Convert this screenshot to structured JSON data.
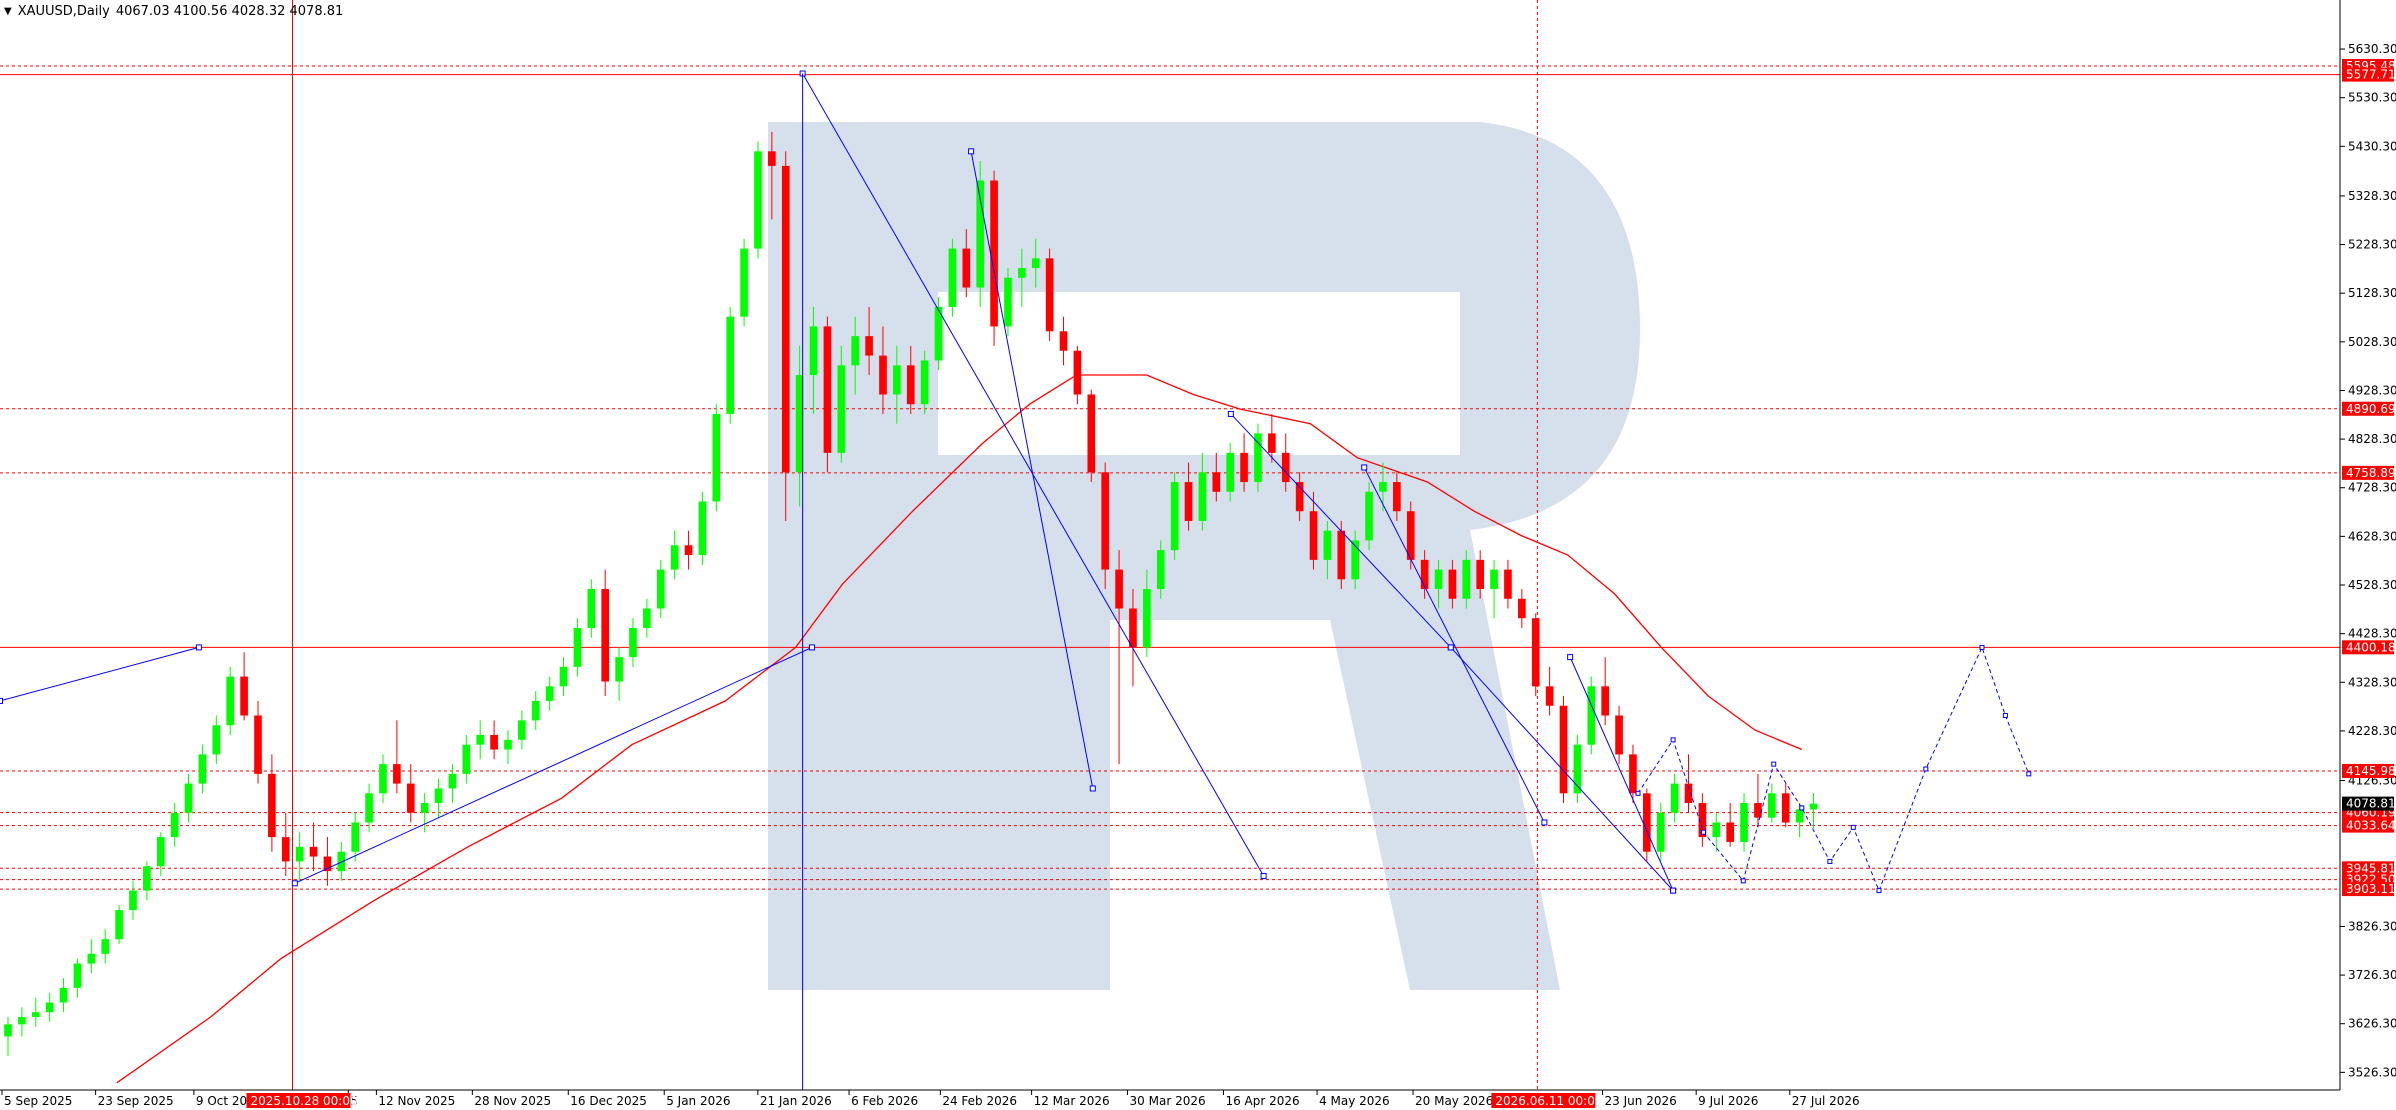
{
  "header": {
    "menu_arrow": "▼",
    "symbol": "XAUUSD,Daily",
    "ohlc": "4067.03 4100.56 4028.32 4078.81"
  },
  "colors": {
    "bull": "#00ff00",
    "bear": "#ff0000",
    "grid_level": "#ff0000",
    "trend": "#0000ff",
    "ma": "#ff0000",
    "watermark": "#d6dfec",
    "label_bg": "#ff0000",
    "label_text": "#ffffff"
  },
  "chart_data": {
    "type": "candlestick",
    "symbol": "XAUUSD",
    "timeframe": "Daily",
    "last_ohlc": {
      "open": 4067.03,
      "high": 4100.56,
      "low": 4028.32,
      "close": 4078.81
    },
    "y_axis_ticks": [
      "5630.30",
      "5530.30",
      "5430.30",
      "5328.30",
      "5228.30",
      "5128.30",
      "5028.30",
      "4928.30",
      "4828.30",
      "4728.30",
      "4628.30",
      "4528.30",
      "4428.30",
      "4328.30",
      "4228.30",
      "4126.30",
      "3826.30",
      "3726.30",
      "3626.30",
      "3526.30"
    ],
    "y_range": [
      3490,
      5690
    ],
    "x_axis_labels": [
      "5 Sep 2025",
      "23 Sep 2025",
      "9 Oct 20",
      "5",
      "12 Nov 2025",
      "28 Nov 2025",
      "16 Dec 2025",
      "5 Jan 2026",
      "21 Jan 2026",
      "6 Feb 2026",
      "24 Feb 2026",
      "12 Mar 2026",
      "30 Mar 2026",
      "16 Apr 2026",
      "4 May 2026",
      "20 May 2026",
      "23 Jun 2026",
      "9 Jul 2026",
      "27 Jul 2026"
    ],
    "x_marker_labels": [
      "2025.10.28 00:00",
      "2026.06.11 00:00"
    ],
    "horizontal_levels": [
      {
        "price": 5595.48,
        "label": "5595.48",
        "style": "dashed"
      },
      {
        "price": 5577.71,
        "label": "5577.71",
        "style": "solid"
      },
      {
        "price": 4890.69,
        "label": "4890.69",
        "style": "dashed"
      },
      {
        "price": 4758.89,
        "label": "4758.89",
        "style": "dashed"
      },
      {
        "price": 4400.18,
        "label": "4400.18",
        "style": "solid"
      },
      {
        "price": 4145.98,
        "label": "4145.98",
        "style": "dashed"
      },
      {
        "price": 4060.19,
        "label": "4060.19",
        "style": "dashed"
      },
      {
        "price": 4033.64,
        "label": "4033.64",
        "style": "dashed"
      },
      {
        "price": 3945.81,
        "label": "3945.81",
        "style": "dashed"
      },
      {
        "price": 3922.5,
        "label": "3922.50",
        "style": "dashed"
      },
      {
        "price": 3903.11,
        "label": "3903.11",
        "style": "dashed"
      }
    ],
    "current_price": {
      "price": 4078.81,
      "label": "4078.81"
    },
    "vertical_markers": [
      {
        "label": "2025.10.28 00:00",
        "style": "solid"
      },
      {
        "label": "2026.06.11 00:00",
        "style": "dashed"
      }
    ],
    "moving_average": [
      {
        "t": 0.05,
        "p": 3505
      },
      {
        "t": 0.09,
        "p": 3640
      },
      {
        "t": 0.12,
        "p": 3760
      },
      {
        "t": 0.16,
        "p": 3880
      },
      {
        "t": 0.2,
        "p": 3990
      },
      {
        "t": 0.24,
        "p": 4090
      },
      {
        "t": 0.27,
        "p": 4200
      },
      {
        "t": 0.31,
        "p": 4290
      },
      {
        "t": 0.34,
        "p": 4400
      },
      {
        "t": 0.36,
        "p": 4530
      },
      {
        "t": 0.39,
        "p": 4680
      },
      {
        "t": 0.42,
        "p": 4820
      },
      {
        "t": 0.44,
        "p": 4900
      },
      {
        "t": 0.46,
        "p": 4960
      },
      {
        "t": 0.49,
        "p": 4960
      },
      {
        "t": 0.51,
        "p": 4920
      },
      {
        "t": 0.53,
        "p": 4890
      },
      {
        "t": 0.56,
        "p": 4860
      },
      {
        "t": 0.58,
        "p": 4790
      },
      {
        "t": 0.61,
        "p": 4740
      },
      {
        "t": 0.63,
        "p": 4680
      },
      {
        "t": 0.65,
        "p": 4630
      },
      {
        "t": 0.67,
        "p": 4590
      },
      {
        "t": 0.69,
        "p": 4510
      },
      {
        "t": 0.71,
        "p": 4400
      },
      {
        "t": 0.73,
        "p": 4300
      },
      {
        "t": 0.75,
        "p": 4230
      },
      {
        "t": 0.77,
        "p": 4190
      }
    ],
    "candles": [
      {
        "o": 3600,
        "h": 3640,
        "l": 3560,
        "c": 3625
      },
      {
        "o": 3625,
        "h": 3660,
        "l": 3600,
        "c": 3640
      },
      {
        "o": 3640,
        "h": 3680,
        "l": 3620,
        "c": 3650
      },
      {
        "o": 3650,
        "h": 3690,
        "l": 3630,
        "c": 3670
      },
      {
        "o": 3670,
        "h": 3720,
        "l": 3650,
        "c": 3700
      },
      {
        "o": 3700,
        "h": 3760,
        "l": 3680,
        "c": 3750
      },
      {
        "o": 3750,
        "h": 3800,
        "l": 3730,
        "c": 3770
      },
      {
        "o": 3770,
        "h": 3820,
        "l": 3750,
        "c": 3800
      },
      {
        "o": 3800,
        "h": 3870,
        "l": 3790,
        "c": 3860
      },
      {
        "o": 3860,
        "h": 3920,
        "l": 3840,
        "c": 3900
      },
      {
        "o": 3900,
        "h": 3960,
        "l": 3880,
        "c": 3950
      },
      {
        "o": 3950,
        "h": 4020,
        "l": 3930,
        "c": 4010
      },
      {
        "o": 4010,
        "h": 4080,
        "l": 3990,
        "c": 4060
      },
      {
        "o": 4060,
        "h": 4140,
        "l": 4040,
        "c": 4120
      },
      {
        "o": 4120,
        "h": 4200,
        "l": 4100,
        "c": 4180
      },
      {
        "o": 4180,
        "h": 4260,
        "l": 4160,
        "c": 4240
      },
      {
        "o": 4240,
        "h": 4360,
        "l": 4220,
        "c": 4340
      },
      {
        "o": 4340,
        "h": 4390,
        "l": 4250,
        "c": 4260
      },
      {
        "o": 4260,
        "h": 4290,
        "l": 4120,
        "c": 4140
      },
      {
        "o": 4140,
        "h": 4180,
        "l": 3980,
        "c": 4010
      },
      {
        "o": 4010,
        "h": 4060,
        "l": 3930,
        "c": 3960
      },
      {
        "o": 3960,
        "h": 4020,
        "l": 3920,
        "c": 3990
      },
      {
        "o": 3990,
        "h": 4040,
        "l": 3940,
        "c": 3970
      },
      {
        "o": 3970,
        "h": 4010,
        "l": 3910,
        "c": 3940
      },
      {
        "o": 3940,
        "h": 4000,
        "l": 3920,
        "c": 3980
      },
      {
        "o": 3980,
        "h": 4060,
        "l": 3960,
        "c": 4040
      },
      {
        "o": 4040,
        "h": 4120,
        "l": 4020,
        "c": 4100
      },
      {
        "o": 4100,
        "h": 4180,
        "l": 4080,
        "c": 4160
      },
      {
        "o": 4160,
        "h": 4250,
        "l": 4100,
        "c": 4120
      },
      {
        "o": 4120,
        "h": 4160,
        "l": 4040,
        "c": 4060
      },
      {
        "o": 4060,
        "h": 4100,
        "l": 4020,
        "c": 4080
      },
      {
        "o": 4080,
        "h": 4130,
        "l": 4050,
        "c": 4110
      },
      {
        "o": 4110,
        "h": 4160,
        "l": 4080,
        "c": 4140
      },
      {
        "o": 4140,
        "h": 4220,
        "l": 4120,
        "c": 4200
      },
      {
        "o": 4200,
        "h": 4250,
        "l": 4170,
        "c": 4220
      },
      {
        "o": 4220,
        "h": 4250,
        "l": 4170,
        "c": 4190
      },
      {
        "o": 4190,
        "h": 4230,
        "l": 4160,
        "c": 4210
      },
      {
        "o": 4210,
        "h": 4270,
        "l": 4190,
        "c": 4250
      },
      {
        "o": 4250,
        "h": 4310,
        "l": 4230,
        "c": 4290
      },
      {
        "o": 4290,
        "h": 4340,
        "l": 4270,
        "c": 4320
      },
      {
        "o": 4320,
        "h": 4380,
        "l": 4300,
        "c": 4360
      },
      {
        "o": 4360,
        "h": 4460,
        "l": 4340,
        "c": 4440
      },
      {
        "o": 4440,
        "h": 4540,
        "l": 4420,
        "c": 4520
      },
      {
        "o": 4520,
        "h": 4560,
        "l": 4300,
        "c": 4330
      },
      {
        "o": 4330,
        "h": 4400,
        "l": 4290,
        "c": 4380
      },
      {
        "o": 4380,
        "h": 4460,
        "l": 4360,
        "c": 4440
      },
      {
        "o": 4440,
        "h": 4500,
        "l": 4420,
        "c": 4480
      },
      {
        "o": 4480,
        "h": 4580,
        "l": 4460,
        "c": 4560
      },
      {
        "o": 4560,
        "h": 4640,
        "l": 4540,
        "c": 4610
      },
      {
        "o": 4610,
        "h": 4640,
        "l": 4560,
        "c": 4590
      },
      {
        "o": 4590,
        "h": 4720,
        "l": 4570,
        "c": 4700
      },
      {
        "o": 4700,
        "h": 4900,
        "l": 4680,
        "c": 4880
      },
      {
        "o": 4880,
        "h": 5100,
        "l": 4860,
        "c": 5080
      },
      {
        "o": 5080,
        "h": 5240,
        "l": 5060,
        "c": 5220
      },
      {
        "o": 5220,
        "h": 5440,
        "l": 5200,
        "c": 5420
      },
      {
        "o": 5420,
        "h": 5460,
        "l": 5280,
        "c": 5390
      },
      {
        "o": 5390,
        "h": 5420,
        "l": 4660,
        "c": 4760
      },
      {
        "o": 4760,
        "h": 5020,
        "l": 4690,
        "c": 4960
      },
      {
        "o": 4960,
        "h": 5100,
        "l": 4880,
        "c": 5060
      },
      {
        "o": 5060,
        "h": 5080,
        "l": 4760,
        "c": 4800
      },
      {
        "o": 4800,
        "h": 5020,
        "l": 4780,
        "c": 4980
      },
      {
        "o": 4980,
        "h": 5080,
        "l": 4920,
        "c": 5040
      },
      {
        "o": 5040,
        "h": 5100,
        "l": 4960,
        "c": 5000
      },
      {
        "o": 5000,
        "h": 5060,
        "l": 4880,
        "c": 4920
      },
      {
        "o": 4920,
        "h": 5020,
        "l": 4860,
        "c": 4980
      },
      {
        "o": 4980,
        "h": 5020,
        "l": 4880,
        "c": 4900
      },
      {
        "o": 4900,
        "h": 5010,
        "l": 4880,
        "c": 4990
      },
      {
        "o": 4990,
        "h": 5120,
        "l": 4970,
        "c": 5100
      },
      {
        "o": 5100,
        "h": 5240,
        "l": 5080,
        "c": 5220
      },
      {
        "o": 5220,
        "h": 5260,
        "l": 5120,
        "c": 5140
      },
      {
        "o": 5140,
        "h": 5400,
        "l": 5100,
        "c": 5360
      },
      {
        "o": 5360,
        "h": 5380,
        "l": 5020,
        "c": 5060
      },
      {
        "o": 5060,
        "h": 5180,
        "l": 5040,
        "c": 5160
      },
      {
        "o": 5160,
        "h": 5220,
        "l": 5100,
        "c": 5180
      },
      {
        "o": 5180,
        "h": 5240,
        "l": 5140,
        "c": 5200
      },
      {
        "o": 5200,
        "h": 5220,
        "l": 5030,
        "c": 5050
      },
      {
        "o": 5050,
        "h": 5080,
        "l": 4980,
        "c": 5010
      },
      {
        "o": 5010,
        "h": 5020,
        "l": 4900,
        "c": 4920
      },
      {
        "o": 4920,
        "h": 4930,
        "l": 4740,
        "c": 4760
      },
      {
        "o": 4760,
        "h": 4780,
        "l": 4520,
        "c": 4560
      },
      {
        "o": 4560,
        "h": 4600,
        "l": 4160,
        "c": 4480
      },
      {
        "o": 4480,
        "h": 4520,
        "l": 4320,
        "c": 4400
      },
      {
        "o": 4400,
        "h": 4560,
        "l": 4380,
        "c": 4520
      },
      {
        "o": 4520,
        "h": 4620,
        "l": 4500,
        "c": 4600
      },
      {
        "o": 4600,
        "h": 4760,
        "l": 4580,
        "c": 4740
      },
      {
        "o": 4740,
        "h": 4780,
        "l": 4640,
        "c": 4660
      },
      {
        "o": 4660,
        "h": 4800,
        "l": 4640,
        "c": 4760
      },
      {
        "o": 4760,
        "h": 4800,
        "l": 4700,
        "c": 4720
      },
      {
        "o": 4720,
        "h": 4820,
        "l": 4700,
        "c": 4800
      },
      {
        "o": 4800,
        "h": 4840,
        "l": 4720,
        "c": 4740
      },
      {
        "o": 4740,
        "h": 4860,
        "l": 4720,
        "c": 4840
      },
      {
        "o": 4840,
        "h": 4880,
        "l": 4780,
        "c": 4800
      },
      {
        "o": 4800,
        "h": 4840,
        "l": 4720,
        "c": 4740
      },
      {
        "o": 4740,
        "h": 4760,
        "l": 4660,
        "c": 4680
      },
      {
        "o": 4680,
        "h": 4720,
        "l": 4560,
        "c": 4580
      },
      {
        "o": 4580,
        "h": 4660,
        "l": 4540,
        "c": 4640
      },
      {
        "o": 4640,
        "h": 4660,
        "l": 4520,
        "c": 4540
      },
      {
        "o": 4540,
        "h": 4640,
        "l": 4520,
        "c": 4620
      },
      {
        "o": 4620,
        "h": 4740,
        "l": 4600,
        "c": 4720
      },
      {
        "o": 4720,
        "h": 4780,
        "l": 4680,
        "c": 4740
      },
      {
        "o": 4740,
        "h": 4760,
        "l": 4660,
        "c": 4680
      },
      {
        "o": 4680,
        "h": 4700,
        "l": 4560,
        "c": 4580
      },
      {
        "o": 4580,
        "h": 4600,
        "l": 4500,
        "c": 4520
      },
      {
        "o": 4520,
        "h": 4580,
        "l": 4480,
        "c": 4560
      },
      {
        "o": 4560,
        "h": 4580,
        "l": 4480,
        "c": 4500
      },
      {
        "o": 4500,
        "h": 4600,
        "l": 4480,
        "c": 4580
      },
      {
        "o": 4580,
        "h": 4600,
        "l": 4500,
        "c": 4520
      },
      {
        "o": 4520,
        "h": 4580,
        "l": 4460,
        "c": 4560
      },
      {
        "o": 4560,
        "h": 4580,
        "l": 4480,
        "c": 4500
      },
      {
        "o": 4500,
        "h": 4520,
        "l": 4440,
        "c": 4460
      },
      {
        "o": 4460,
        "h": 4470,
        "l": 4300,
        "c": 4320
      },
      {
        "o": 4320,
        "h": 4360,
        "l": 4260,
        "c": 4280
      },
      {
        "o": 4280,
        "h": 4300,
        "l": 4080,
        "c": 4100
      },
      {
        "o": 4100,
        "h": 4220,
        "l": 4080,
        "c": 4200
      },
      {
        "o": 4200,
        "h": 4340,
        "l": 4180,
        "c": 4320
      },
      {
        "o": 4320,
        "h": 4380,
        "l": 4240,
        "c": 4260
      },
      {
        "o": 4260,
        "h": 4280,
        "l": 4160,
        "c": 4180
      },
      {
        "o": 4180,
        "h": 4200,
        "l": 4080,
        "c": 4100
      },
      {
        "o": 4100,
        "h": 4110,
        "l": 3960,
        "c": 3980
      },
      {
        "o": 3980,
        "h": 4080,
        "l": 3960,
        "c": 4060
      },
      {
        "o": 4060,
        "h": 4140,
        "l": 4040,
        "c": 4120
      },
      {
        "o": 4120,
        "h": 4180,
        "l": 4060,
        "c": 4080
      },
      {
        "o": 4080,
        "h": 4100,
        "l": 3990,
        "c": 4010
      },
      {
        "o": 4010,
        "h": 4060,
        "l": 3980,
        "c": 4040
      },
      {
        "o": 4040,
        "h": 4080,
        "l": 3990,
        "c": 4000
      },
      {
        "o": 4000,
        "h": 4100,
        "l": 3980,
        "c": 4080
      },
      {
        "o": 4080,
        "h": 4140,
        "l": 4030,
        "c": 4050
      },
      {
        "o": 4050,
        "h": 4120,
        "l": 4040,
        "c": 4100
      },
      {
        "o": 4100,
        "h": 4120,
        "l": 4030,
        "c": 4040
      },
      {
        "o": 4040,
        "h": 4080,
        "l": 4010,
        "c": 4067
      },
      {
        "o": 4067.03,
        "h": 4100.56,
        "l": 4028.32,
        "c": 4078.81
      }
    ],
    "trend_lines": [
      {
        "from": {
          "t": 0.0,
          "p": 4290
        },
        "to": {
          "t": 0.085,
          "p": 4400
        }
      },
      {
        "from": {
          "t": 0.126,
          "p": 3915
        },
        "to": {
          "t": 0.347,
          "p": 4400
        }
      },
      {
        "from": {
          "t": 0.343,
          "p": 5580
        },
        "to": {
          "t": 0.54,
          "p": 3930
        }
      },
      {
        "from": {
          "t": 0.415,
          "p": 5420
        },
        "to": {
          "t": 0.467,
          "p": 4110
        }
      },
      {
        "from": {
          "t": 0.526,
          "p": 4880
        },
        "to": {
          "t": 0.62,
          "p": 4400
        }
      },
      {
        "from": {
          "t": 0.583,
          "p": 4770
        },
        "to": {
          "t": 0.66,
          "p": 4040
        }
      },
      {
        "from": {
          "t": 0.62,
          "p": 4400
        },
        "to": {
          "t": 0.715,
          "p": 3900
        }
      },
      {
        "from": {
          "t": 0.671,
          "p": 4380
        },
        "to": {
          "t": 0.715,
          "p": 3900
        }
      }
    ],
    "projection_path": [
      {
        "t": 0.7,
        "p": 4100
      },
      {
        "t": 0.715,
        "p": 4210
      },
      {
        "t": 0.728,
        "p": 4020
      },
      {
        "t": 0.745,
        "p": 3920
      },
      {
        "t": 0.758,
        "p": 4160
      },
      {
        "t": 0.77,
        "p": 4070
      },
      {
        "t": 0.782,
        "p": 3960
      },
      {
        "t": 0.792,
        "p": 4030
      },
      {
        "t": 0.803,
        "p": 3900
      },
      {
        "t": 0.823,
        "p": 4150
      },
      {
        "t": 0.847,
        "p": 4400
      },
      {
        "t": 0.857,
        "p": 4260
      },
      {
        "t": 0.867,
        "p": 4140
      }
    ],
    "title": "",
    "xlabel": "",
    "ylabel": "",
    "grid": false
  }
}
